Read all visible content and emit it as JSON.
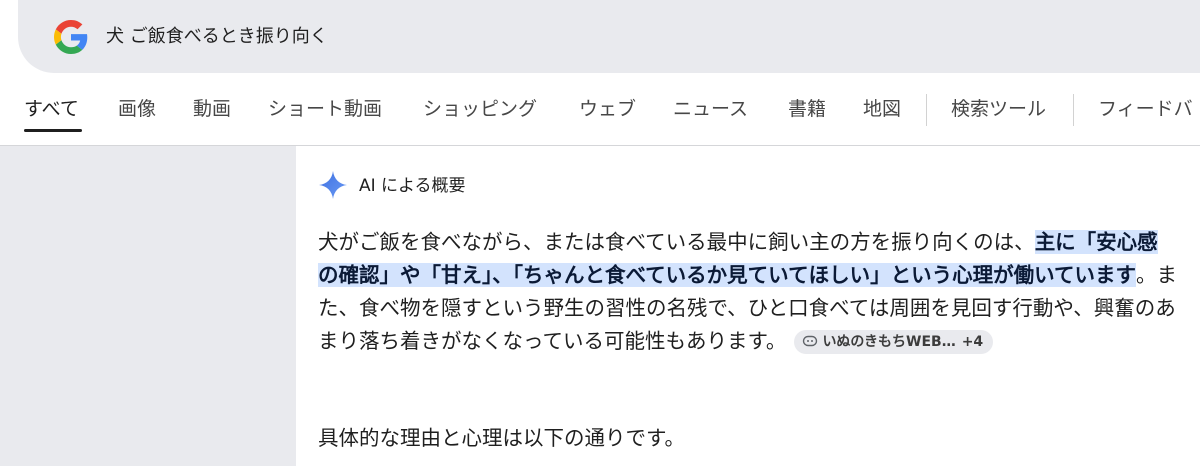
{
  "search": {
    "query": "犬 ご飯食べるとき振り向く"
  },
  "tabs": [
    {
      "label": "すべて",
      "active": true
    },
    {
      "label": "画像"
    },
    {
      "label": "動画"
    },
    {
      "label": "ショート動画"
    },
    {
      "label": "ショッピング"
    },
    {
      "label": "ウェブ"
    },
    {
      "label": "ニュース"
    },
    {
      "label": "書籍"
    },
    {
      "label": "地図"
    },
    {
      "label": "検索ツール"
    },
    {
      "label": "フィードバ"
    }
  ],
  "ai_overview": {
    "title": "AI による概要",
    "paragraph": {
      "text_before": "犬がご飯を食べながら、または食べている最中に飼い主の方を振り向くのは、",
      "highlight": "主に「安心感の確認」や「甘え」、「ちゃんと食べているか見ていてほしい」という心理が働いています",
      "text_after": "。また、食べ物を隠すという野生の習性の名残で、ひと口食べては周囲を見回す行動や、興奮のあまり落ち着きがなくなっている可能性もあります。"
    },
    "source_chip": {
      "label": "いぬのきもちWEB…",
      "count": "+4"
    },
    "sub_paragraph": "具体的な理由と心理は以下の通りです。"
  },
  "colors": {
    "highlight_bg": "#d3e3fd",
    "sparkle": "#4f7fe8",
    "panel_bg": "#e9eaee"
  }
}
